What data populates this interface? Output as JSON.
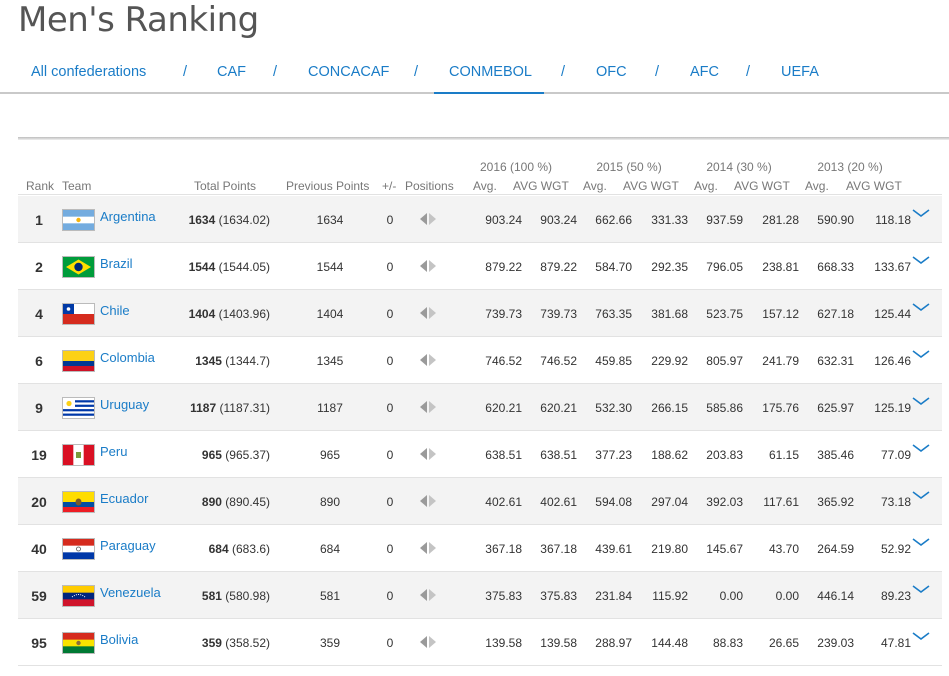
{
  "page": {
    "title": "Men's Ranking"
  },
  "confederations": {
    "tabs": [
      "All confederations",
      "CAF",
      "CONCACAF",
      "CONMEBOL",
      "OFC",
      "AFC",
      "UEFA"
    ],
    "separator": "/",
    "active": "CONMEBOL"
  },
  "table": {
    "year_headers": [
      "2016 (100 %)",
      "2015 (50 %)",
      "2014 (30 %)",
      "2013 (20 %)"
    ],
    "columns": {
      "rank": "Rank",
      "team": "Team",
      "total": "Total Points",
      "previous": "Previous Points",
      "plusminus": "+/-",
      "positions": "Positions",
      "avg": "Avg.",
      "avg_wgt": "AVG WGT"
    },
    "rows": [
      {
        "rank": "1",
        "team": "Argentina",
        "flag": "argentina",
        "total": "1634",
        "total_exact": "(1634.02)",
        "prev": "1634",
        "pm": "0",
        "y16": "903.24",
        "y16w": "903.24",
        "y15": "662.66",
        "y15w": "331.33",
        "y14": "937.59",
        "y14w": "281.28",
        "y13": "590.90",
        "y13w": "118.18"
      },
      {
        "rank": "2",
        "team": "Brazil",
        "flag": "brazil",
        "total": "1544",
        "total_exact": "(1544.05)",
        "prev": "1544",
        "pm": "0",
        "y16": "879.22",
        "y16w": "879.22",
        "y15": "584.70",
        "y15w": "292.35",
        "y14": "796.05",
        "y14w": "238.81",
        "y13": "668.33",
        "y13w": "133.67"
      },
      {
        "rank": "4",
        "team": "Chile",
        "flag": "chile",
        "total": "1404",
        "total_exact": "(1403.96)",
        "prev": "1404",
        "pm": "0",
        "y16": "739.73",
        "y16w": "739.73",
        "y15": "763.35",
        "y15w": "381.68",
        "y14": "523.75",
        "y14w": "157.12",
        "y13": "627.18",
        "y13w": "125.44"
      },
      {
        "rank": "6",
        "team": "Colombia",
        "flag": "colombia",
        "total": "1345",
        "total_exact": "(1344.7)",
        "prev": "1345",
        "pm": "0",
        "y16": "746.52",
        "y16w": "746.52",
        "y15": "459.85",
        "y15w": "229.92",
        "y14": "805.97",
        "y14w": "241.79",
        "y13": "632.31",
        "y13w": "126.46"
      },
      {
        "rank": "9",
        "team": "Uruguay",
        "flag": "uruguay",
        "total": "1187",
        "total_exact": "(1187.31)",
        "prev": "1187",
        "pm": "0",
        "y16": "620.21",
        "y16w": "620.21",
        "y15": "532.30",
        "y15w": "266.15",
        "y14": "585.86",
        "y14w": "175.76",
        "y13": "625.97",
        "y13w": "125.19"
      },
      {
        "rank": "19",
        "team": "Peru",
        "flag": "peru",
        "total": "965",
        "total_exact": "(965.37)",
        "prev": "965",
        "pm": "0",
        "y16": "638.51",
        "y16w": "638.51",
        "y15": "377.23",
        "y15w": "188.62",
        "y14": "203.83",
        "y14w": "61.15",
        "y13": "385.46",
        "y13w": "77.09"
      },
      {
        "rank": "20",
        "team": "Ecuador",
        "flag": "ecuador",
        "total": "890",
        "total_exact": "(890.45)",
        "prev": "890",
        "pm": "0",
        "y16": "402.61",
        "y16w": "402.61",
        "y15": "594.08",
        "y15w": "297.04",
        "y14": "392.03",
        "y14w": "117.61",
        "y13": "365.92",
        "y13w": "73.18"
      },
      {
        "rank": "40",
        "team": "Paraguay",
        "flag": "paraguay",
        "total": "684",
        "total_exact": "(683.6)",
        "prev": "684",
        "pm": "0",
        "y16": "367.18",
        "y16w": "367.18",
        "y15": "439.61",
        "y15w": "219.80",
        "y14": "145.67",
        "y14w": "43.70",
        "y13": "264.59",
        "y13w": "52.92"
      },
      {
        "rank": "59",
        "team": "Venezuela",
        "flag": "venezuela",
        "total": "581",
        "total_exact": "(580.98)",
        "prev": "581",
        "pm": "0",
        "y16": "375.83",
        "y16w": "375.83",
        "y15": "231.84",
        "y15w": "115.92",
        "y14": "0.00",
        "y14w": "0.00",
        "y13": "446.14",
        "y13w": "89.23"
      },
      {
        "rank": "95",
        "team": "Bolivia",
        "flag": "bolivia",
        "total": "359",
        "total_exact": "(358.52)",
        "prev": "359",
        "pm": "0",
        "y16": "139.58",
        "y16w": "139.58",
        "y15": "288.97",
        "y15w": "144.48",
        "y14": "88.83",
        "y14w": "26.65",
        "y13": "239.03",
        "y13w": "47.81"
      }
    ]
  },
  "icons": {
    "positions": "positions-arrows-icon",
    "expand": "chevron-down-icon"
  },
  "colors": {
    "link": "#1a7cc7",
    "stripe": "#f3f3f3",
    "header_text": "#777777"
  }
}
